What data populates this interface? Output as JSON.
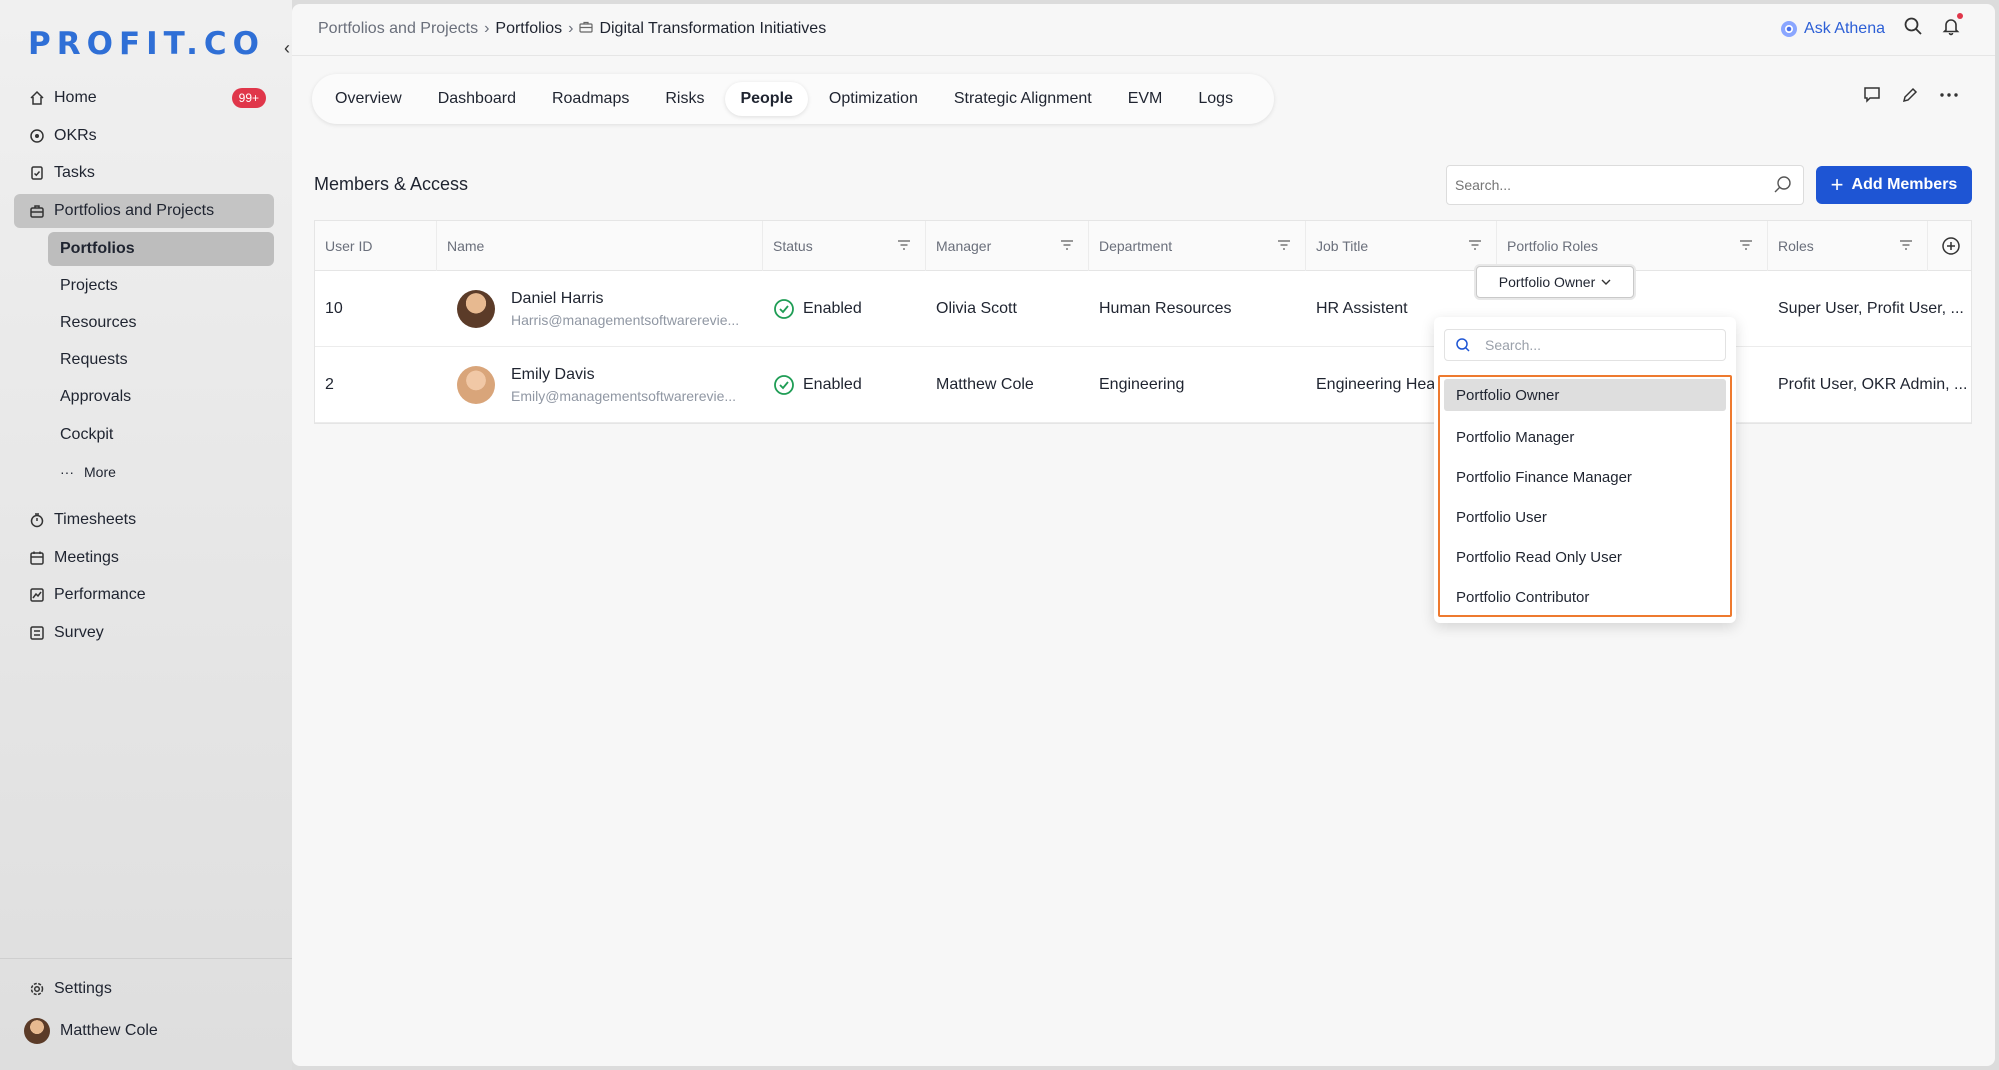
{
  "brand": {
    "logo": "PROFIT.CO"
  },
  "sidebar": {
    "home": "Home",
    "home_badge": "99+",
    "okrs": "OKRs",
    "tasks": "Tasks",
    "portfolios_projects": "Portfolios and Projects",
    "sub": [
      "Portfolios",
      "Projects",
      "Resources",
      "Requests",
      "Approvals",
      "Cockpit"
    ],
    "more": "More",
    "timesheets": "Timesheets",
    "meetings": "Meetings",
    "performance": "Performance",
    "survey": "Survey",
    "settings": "Settings",
    "user_name": "Matthew Cole"
  },
  "breadcrumb": {
    "root": "Portfolios and Projects",
    "sep": "›",
    "mid": "Portfolios",
    "current": "Digital Transformation Initiatives"
  },
  "topbar": {
    "ask": "Ask Athena"
  },
  "tabs": [
    "Overview",
    "Dashboard",
    "Roadmaps",
    "Risks",
    "People",
    "Optimization",
    "Strategic Alignment",
    "EVM",
    "Logs"
  ],
  "section": {
    "title": "Members & Access"
  },
  "search": {
    "placeholder": "Search..."
  },
  "add_button": "Add Members",
  "table": {
    "headers": [
      "User ID",
      "Name",
      "Status",
      "Manager",
      "Department",
      "Job Title",
      "Portfolio Roles",
      "Roles"
    ],
    "rows": [
      {
        "id": "10",
        "name": "Daniel Harris",
        "email": "Harris@managementsoftwarerevie...",
        "status": "Enabled",
        "manager": "Olivia Scott",
        "department": "Human Resources",
        "job": "HR Assistent",
        "portfolio_role": "Portfolio Owner",
        "roles": "Super User, Profit User, ..."
      },
      {
        "id": "2",
        "name": "Emily Davis",
        "email": "Emily@managementsoftwarerevie...",
        "status": "Enabled",
        "manager": "Matthew Cole",
        "department": "Engineering",
        "job": "Engineering Hea",
        "portfolio_role": "",
        "roles": "Profit User, OKR Admin, ..."
      }
    ]
  },
  "dropdown": {
    "placeholder": "Search...",
    "options": [
      "Portfolio Owner",
      "Portfolio Manager",
      "Portfolio Finance Manager",
      "Portfolio User",
      "Portfolio Read Only User",
      "Portfolio Contributor"
    ]
  }
}
